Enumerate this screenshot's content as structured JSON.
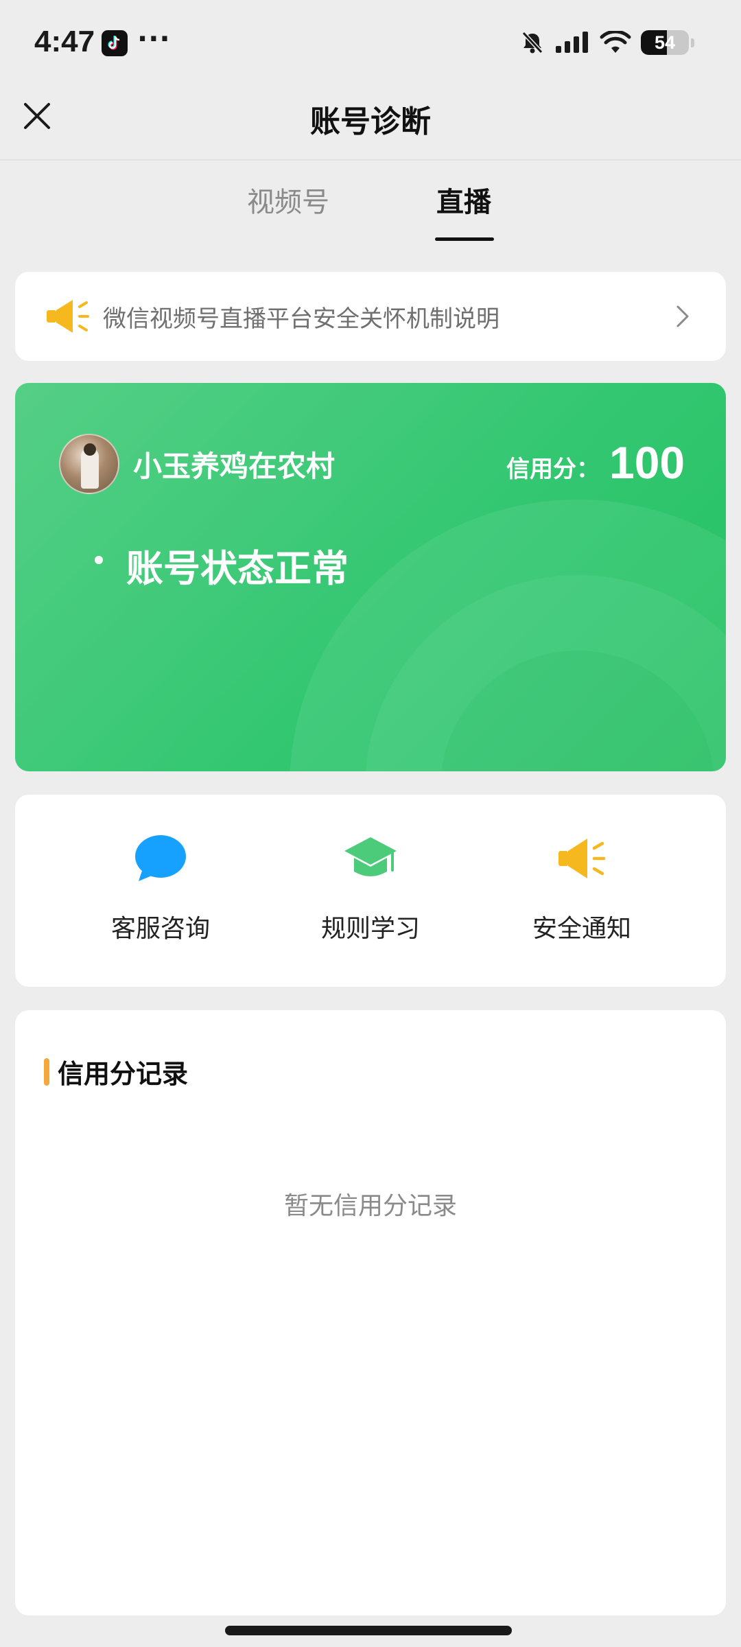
{
  "status_bar": {
    "time": "4:47",
    "more": "···",
    "battery_level": "54",
    "battery_fraction": 0.54,
    "icons": [
      "tiktok-icon",
      "bell-muted-icon",
      "cellular-signal-icon",
      "wifi-icon",
      "battery-icon"
    ]
  },
  "nav": {
    "title": "账号诊断",
    "close_icon": "close-icon"
  },
  "tabs": [
    {
      "label": "视频号",
      "active": false
    },
    {
      "label": "直播",
      "active": true
    }
  ],
  "notice": {
    "icon": "megaphone-icon",
    "text": "微信视频号直播平台安全关怀机制说明",
    "chevron": "chevron-right-icon"
  },
  "account": {
    "username": "小玉养鸡在农村",
    "credit_label": "信用分：",
    "credit_score": "100",
    "status": "账号状态正常"
  },
  "actions": [
    {
      "label": "客服咨询",
      "icon": "chat-bubble-icon"
    },
    {
      "label": "规则学习",
      "icon": "graduation-cap-icon"
    },
    {
      "label": "安全通知",
      "icon": "megaphone-icon"
    }
  ],
  "records": {
    "title": "信用分记录",
    "empty_text": "暂无信用分记录"
  },
  "colors": {
    "green_card": "#34C772",
    "accent_orange": "#F4A83B",
    "megaphone_yellow": "#F5B91F",
    "chat_blue": "#16A1FF",
    "cap_green": "#4CCB7A",
    "page_background": "#EDEDED"
  }
}
